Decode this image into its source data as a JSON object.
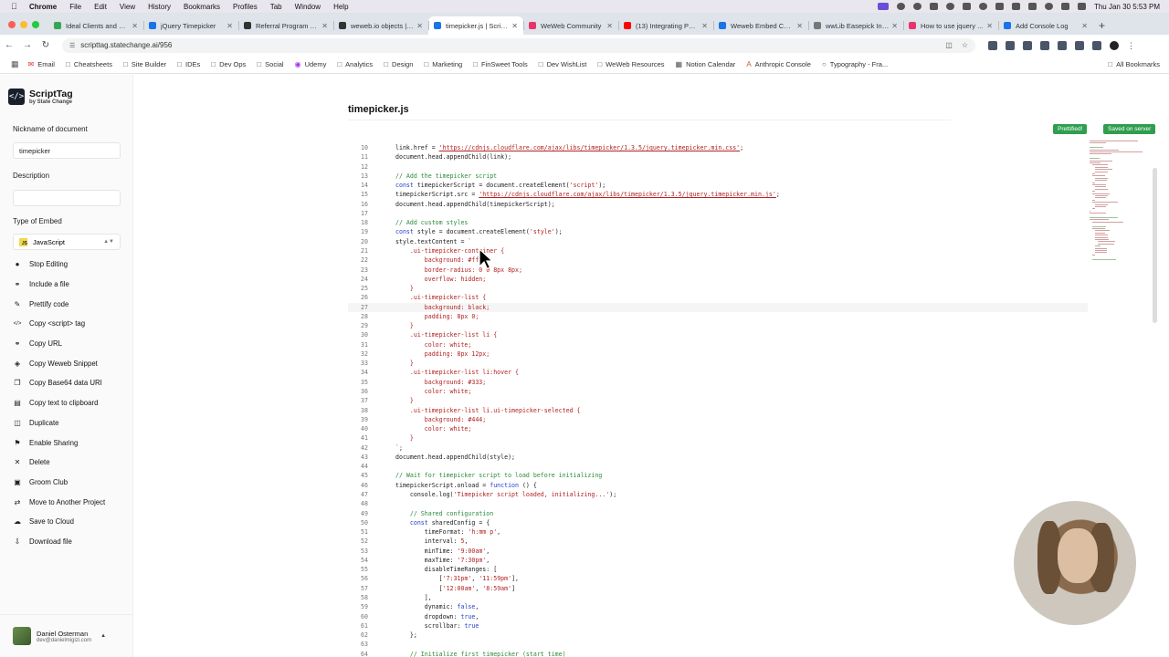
{
  "menubar": {
    "app": "Chrome",
    "items": [
      "File",
      "Edit",
      "View",
      "History",
      "Bookmarks",
      "Profiles",
      "Tab",
      "Window",
      "Help"
    ],
    "clock": "Thu Jan 30  5:53 PM"
  },
  "tabs": [
    {
      "label": "Ideal Clients and Le...",
      "color": "#34a853",
      "active": false
    },
    {
      "label": "jQuery Timepicker",
      "color": "#1a73e8",
      "active": false
    },
    {
      "label": "Referral Program A...",
      "color": "#333333",
      "active": false
    },
    {
      "label": "weweb.io objects | ...",
      "color": "#333333",
      "active": false
    },
    {
      "label": "timepicker.js | Scrip...",
      "color": "#1a73e8",
      "active": true
    },
    {
      "label": "WeWeb Community",
      "color": "#e8336d",
      "active": false
    },
    {
      "label": "(13) Integrating Pow...",
      "color": "#ff0000",
      "active": false
    },
    {
      "label": "Weweb Embed Cod...",
      "color": "#1a73e8",
      "active": false
    },
    {
      "label": "wwLib Easepick Ins...",
      "color": "#777777",
      "active": false
    },
    {
      "label": "How to use jquery ...",
      "color": "#e8336d",
      "active": false
    },
    {
      "label": "Add Console Log",
      "color": "#1a73e8",
      "active": false
    }
  ],
  "address": {
    "url": "scripttag.statechange.ai/956"
  },
  "bookmarks": [
    {
      "label": "Email",
      "icon": "mail-icon"
    },
    {
      "label": "Cheatsheets",
      "icon": "folder-icon"
    },
    {
      "label": "Site Builder",
      "icon": "folder-icon"
    },
    {
      "label": "IDEs",
      "icon": "folder-icon"
    },
    {
      "label": "Dev Ops",
      "icon": "folder-icon"
    },
    {
      "label": "Social",
      "icon": "folder-icon"
    },
    {
      "label": "Udemy",
      "icon": "udemy-icon"
    },
    {
      "label": "Analytics",
      "icon": "folder-icon"
    },
    {
      "label": "Design",
      "icon": "folder-icon"
    },
    {
      "label": "Marketing",
      "icon": "folder-icon"
    },
    {
      "label": "FinSweet Tools",
      "icon": "folder-icon"
    },
    {
      "label": "Dev WishList",
      "icon": "folder-icon"
    },
    {
      "label": "WeWeb Resources",
      "icon": "folder-icon"
    },
    {
      "label": "Notion Calendar",
      "icon": "calendar-icon"
    },
    {
      "label": "Anthropic Console",
      "icon": "anthropic-icon"
    },
    {
      "label": "Typography - Fra...",
      "icon": "globe-icon"
    }
  ],
  "all_bookmarks": "All Bookmarks",
  "sidebar": {
    "brand": "ScriptTag",
    "brand_sub": "by State Change",
    "nickname_label": "Nickname of document",
    "nickname_value": "timepicker",
    "description_label": "Description",
    "description_value": "",
    "embed_label": "Type of Embed",
    "embed_value": "JavaScript",
    "actions": [
      {
        "label": "Stop Editing",
        "icon": "pencil-icon"
      },
      {
        "label": "Include a file",
        "icon": "link-icon"
      },
      {
        "label": "Prettify code",
        "icon": "brush-icon"
      },
      {
        "label": "Copy <script> tag",
        "icon": "code-icon"
      },
      {
        "label": "Copy URL",
        "icon": "link-icon"
      },
      {
        "label": "Copy Weweb Snippet",
        "icon": "snippet-icon"
      },
      {
        "label": "Copy Base64 data URI",
        "icon": "copy-icon"
      },
      {
        "label": "Copy text to clipboard",
        "icon": "clipboard-icon"
      },
      {
        "label": "Duplicate",
        "icon": "duplicate-icon"
      },
      {
        "label": "Enable Sharing",
        "icon": "share-icon"
      },
      {
        "label": "Delete",
        "icon": "trash-icon"
      },
      {
        "label": "Groom Club",
        "icon": "club-icon"
      },
      {
        "label": "Move to Another Project",
        "icon": "move-icon"
      },
      {
        "label": "Save to Cloud",
        "icon": "cloud-icon"
      },
      {
        "label": "Download file",
        "icon": "download-icon"
      }
    ],
    "user_name": "Daniel Osterman",
    "user_email": "dev@danielmigizi.com"
  },
  "main": {
    "doc_title": "timepicker.js",
    "badge_prettified": "Prettified!",
    "badge_saved": "Saved on server",
    "badge_color": "#2f9e4f"
  },
  "code": [
    {
      "n": "10",
      "i": 0,
      "t": [
        [
          "p",
          "link.href = "
        ],
        [
          "u",
          "'https://cdnjs.cloudflare.com/ajax/libs/timepicker/1.3.5/jquery.timepicker.min.css'"
        ],
        [
          "p",
          ";"
        ]
      ]
    },
    {
      "n": "11",
      "i": 0,
      "t": [
        [
          "p",
          "document.head.appendChild(link);"
        ]
      ]
    },
    {
      "n": "12",
      "i": 0,
      "t": []
    },
    {
      "n": "13",
      "i": 0,
      "t": [
        [
          "c",
          "// Add the timepicker script"
        ]
      ]
    },
    {
      "n": "14",
      "i": 0,
      "t": [
        [
          "k",
          "const "
        ],
        [
          "p",
          "timepickerScript = document.createElement("
        ],
        [
          "s",
          "'script'"
        ],
        [
          "p",
          ");"
        ]
      ]
    },
    {
      "n": "15",
      "i": 0,
      "t": [
        [
          "p",
          "timepickerScript.src = "
        ],
        [
          "u",
          "'https://cdnjs.cloudflare.com/ajax/libs/timepicker/1.3.5/jquery.timepicker.min.js'"
        ],
        [
          "p",
          ";"
        ]
      ]
    },
    {
      "n": "16",
      "i": 0,
      "t": [
        [
          "p",
          "document.head.appendChild(timepickerScript);"
        ]
      ]
    },
    {
      "n": "17",
      "i": 0,
      "t": []
    },
    {
      "n": "18",
      "i": 0,
      "t": [
        [
          "c",
          "// Add custom styles"
        ]
      ]
    },
    {
      "n": "19",
      "i": 0,
      "t": [
        [
          "k",
          "const "
        ],
        [
          "p",
          "style = document.createElement("
        ],
        [
          "s",
          "'style'"
        ],
        [
          "p",
          ");"
        ]
      ]
    },
    {
      "n": "20",
      "i": 0,
      "t": [
        [
          "p",
          "style.textContent = "
        ],
        [
          "s",
          "`"
        ]
      ]
    },
    {
      "n": "21",
      "i": 1,
      "t": [
        [
          "s",
          ".ui-timepicker-container {"
        ]
      ]
    },
    {
      "n": "22",
      "i": 2,
      "t": [
        [
          "s",
          "background: #fff;"
        ]
      ]
    },
    {
      "n": "23",
      "i": 2,
      "t": [
        [
          "s",
          "border-radius: 0 0 8px 8px;"
        ]
      ]
    },
    {
      "n": "24",
      "i": 2,
      "t": [
        [
          "s",
          "overflow: hidden;"
        ]
      ]
    },
    {
      "n": "25",
      "i": 1,
      "t": [
        [
          "s",
          "}"
        ]
      ]
    },
    {
      "n": "26",
      "i": 1,
      "t": [
        [
          "s",
          ".ui-timepicker-list {"
        ]
      ]
    },
    {
      "n": "27",
      "i": 2,
      "t": [
        [
          "s",
          "background: black;"
        ]
      ],
      "current": true
    },
    {
      "n": "28",
      "i": 2,
      "t": [
        [
          "s",
          "padding: 8px 0;"
        ]
      ]
    },
    {
      "n": "29",
      "i": 1,
      "t": [
        [
          "s",
          "}"
        ]
      ]
    },
    {
      "n": "30",
      "i": 1,
      "t": [
        [
          "s",
          ".ui-timepicker-list li {"
        ]
      ]
    },
    {
      "n": "31",
      "i": 2,
      "t": [
        [
          "s",
          "color: white;"
        ]
      ]
    },
    {
      "n": "32",
      "i": 2,
      "t": [
        [
          "s",
          "padding: 8px 12px;"
        ]
      ]
    },
    {
      "n": "33",
      "i": 1,
      "t": [
        [
          "s",
          "}"
        ]
      ]
    },
    {
      "n": "34",
      "i": 1,
      "t": [
        [
          "s",
          ".ui-timepicker-list li:hover {"
        ]
      ]
    },
    {
      "n": "35",
      "i": 2,
      "t": [
        [
          "s",
          "background: #333;"
        ]
      ]
    },
    {
      "n": "36",
      "i": 2,
      "t": [
        [
          "s",
          "color: white;"
        ]
      ]
    },
    {
      "n": "37",
      "i": 1,
      "t": [
        [
          "s",
          "}"
        ]
      ]
    },
    {
      "n": "38",
      "i": 1,
      "t": [
        [
          "s",
          ".ui-timepicker-list li.ui-timepicker-selected {"
        ]
      ]
    },
    {
      "n": "39",
      "i": 2,
      "t": [
        [
          "s",
          "background: #444;"
        ]
      ]
    },
    {
      "n": "40",
      "i": 2,
      "t": [
        [
          "s",
          "color: white;"
        ]
      ]
    },
    {
      "n": "41",
      "i": 1,
      "t": [
        [
          "s",
          "}"
        ]
      ]
    },
    {
      "n": "42",
      "i": 0,
      "t": [
        [
          "s",
          "`"
        ],
        [
          "p",
          ";"
        ]
      ]
    },
    {
      "n": "43",
      "i": 0,
      "t": [
        [
          "p",
          "document.head.appendChild(style);"
        ]
      ]
    },
    {
      "n": "44",
      "i": 0,
      "t": []
    },
    {
      "n": "45",
      "i": 0,
      "t": [
        [
          "c",
          "// Wait for timepicker script to load before initializing"
        ]
      ]
    },
    {
      "n": "46",
      "i": 0,
      "t": [
        [
          "p",
          "timepickerScript.onload = "
        ],
        [
          "k",
          "function "
        ],
        [
          "p",
          "() {"
        ]
      ]
    },
    {
      "n": "47",
      "i": 1,
      "t": [
        [
          "p",
          "console.log("
        ],
        [
          "s",
          "'Timepicker script loaded, initializing...'"
        ],
        [
          "p",
          ");"
        ]
      ]
    },
    {
      "n": "48",
      "i": 0,
      "t": []
    },
    {
      "n": "49",
      "i": 1,
      "t": [
        [
          "c",
          "// Shared configuration"
        ]
      ]
    },
    {
      "n": "50",
      "i": 1,
      "t": [
        [
          "k",
          "const "
        ],
        [
          "p",
          "sharedConfig = {"
        ]
      ]
    },
    {
      "n": "51",
      "i": 2,
      "t": [
        [
          "p",
          "timeFormat: "
        ],
        [
          "s",
          "'h:mm p'"
        ],
        [
          "p",
          ","
        ]
      ]
    },
    {
      "n": "52",
      "i": 2,
      "t": [
        [
          "p",
          "interval: "
        ],
        [
          "s",
          "5"
        ],
        [
          "p",
          ","
        ]
      ]
    },
    {
      "n": "53",
      "i": 2,
      "t": [
        [
          "p",
          "minTime: "
        ],
        [
          "s",
          "'9:00am'"
        ],
        [
          "p",
          ","
        ]
      ]
    },
    {
      "n": "54",
      "i": 2,
      "t": [
        [
          "p",
          "maxTime: "
        ],
        [
          "s",
          "'7:30pm'"
        ],
        [
          "p",
          ","
        ]
      ]
    },
    {
      "n": "55",
      "i": 2,
      "t": [
        [
          "p",
          "disableTimeRanges: ["
        ]
      ]
    },
    {
      "n": "56",
      "i": 3,
      "t": [
        [
          "p",
          "["
        ],
        [
          "s",
          "'7:31pm'"
        ],
        [
          "p",
          ", "
        ],
        [
          "s",
          "'11:59pm'"
        ],
        [
          "p",
          "],"
        ]
      ]
    },
    {
      "n": "57",
      "i": 3,
      "t": [
        [
          "p",
          "["
        ],
        [
          "s",
          "'12:00am'"
        ],
        [
          "p",
          ", "
        ],
        [
          "s",
          "'8:59am'"
        ],
        [
          "p",
          "]"
        ]
      ]
    },
    {
      "n": "58",
      "i": 2,
      "t": [
        [
          "p",
          "],"
        ]
      ]
    },
    {
      "n": "59",
      "i": 2,
      "t": [
        [
          "p",
          "dynamic: "
        ],
        [
          "k",
          "false"
        ],
        [
          "p",
          ","
        ]
      ]
    },
    {
      "n": "60",
      "i": 2,
      "t": [
        [
          "p",
          "dropdown: "
        ],
        [
          "k",
          "true"
        ],
        [
          "p",
          ","
        ]
      ]
    },
    {
      "n": "61",
      "i": 2,
      "t": [
        [
          "p",
          "scrollbar: "
        ],
        [
          "k",
          "true"
        ]
      ]
    },
    {
      "n": "62",
      "i": 1,
      "t": [
        [
          "p",
          "};"
        ]
      ]
    },
    {
      "n": "63",
      "i": 0,
      "t": []
    },
    {
      "n": "64",
      "i": 1,
      "t": [
        [
          "c",
          "// Initialize first timepicker (start time)"
        ]
      ]
    }
  ]
}
